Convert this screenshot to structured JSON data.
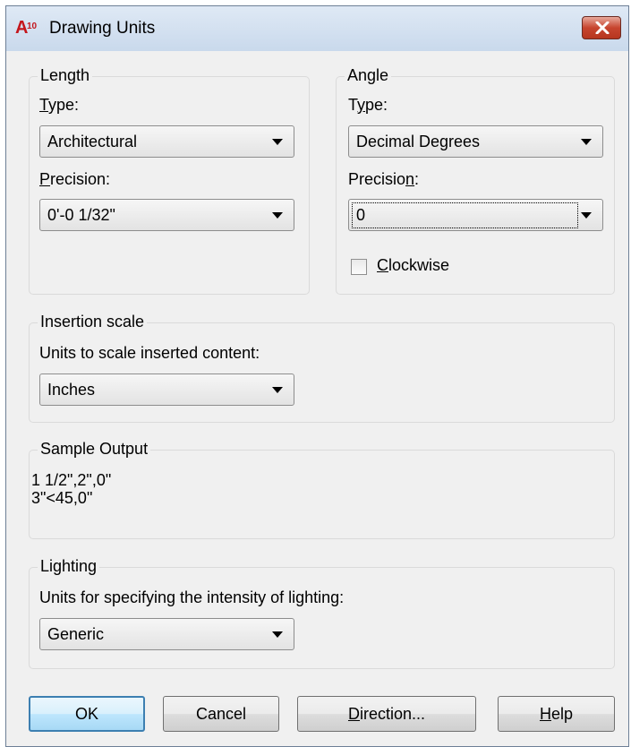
{
  "window": {
    "title": "Drawing Units",
    "app_icon_text": "A10"
  },
  "length": {
    "legend": "Length",
    "type_label": "Type:",
    "type_value": "Architectural",
    "precision_label": "Precision:",
    "precision_value": "0'-0 1/32\""
  },
  "angle": {
    "legend": "Angle",
    "type_label": "Type:",
    "type_value": "Decimal Degrees",
    "precision_label": "Precision:",
    "precision_value": "0",
    "clockwise_label": "Clockwise",
    "clockwise_checked": false
  },
  "insertion": {
    "legend": "Insertion scale",
    "label": "Units to scale inserted content:",
    "value": "Inches"
  },
  "sample": {
    "legend": "Sample Output",
    "line1": "1 1/2\",2\",0\"",
    "line2": "3\"<45,0\""
  },
  "lighting": {
    "legend": "Lighting",
    "label": "Units for specifying the intensity of lighting:",
    "value": "Generic"
  },
  "buttons": {
    "ok": "OK",
    "cancel": "Cancel",
    "direction": "Direction...",
    "help": "Help"
  }
}
